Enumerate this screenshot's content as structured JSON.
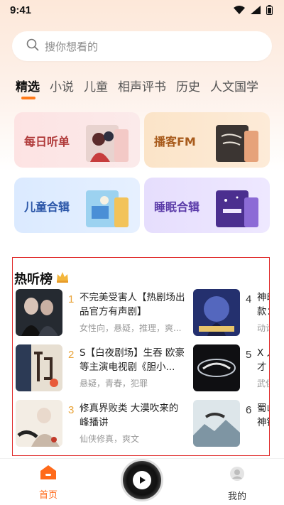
{
  "status": {
    "time": "9:41",
    "icons": [
      "wifi-icon",
      "signal-icon",
      "battery-icon"
    ]
  },
  "search": {
    "placeholder": "搜你想看的",
    "icon": "search-icon"
  },
  "tabs": [
    {
      "label": "精选",
      "active": true
    },
    {
      "label": "小说",
      "active": false
    },
    {
      "label": "儿童",
      "active": false
    },
    {
      "label": "相声评书",
      "active": false
    },
    {
      "label": "历史",
      "active": false
    },
    {
      "label": "人文国学",
      "active": false
    }
  ],
  "cards": [
    {
      "label": "每日听单"
    },
    {
      "label": "播客FM"
    },
    {
      "label": "儿童合辑"
    },
    {
      "label": "睡眠合辑"
    }
  ],
  "ranking": {
    "title": "热听榜",
    "items": [
      {
        "rank": "1",
        "name": "不完美受害人【热剧场出品官方有声剧】",
        "tags": "女性向，悬疑，推理，爽..."
      },
      {
        "rank": "2",
        "name": "S【白夜剧场】生吞 欧豪等主演电视剧《胆小...",
        "tags": "悬疑，青春，犯罪"
      },
      {
        "rank": "3",
        "name": "修真界败类 大漠吹来的峰播讲",
        "tags": "仙侠修真，爽文"
      },
      {
        "rank": "4",
        "name": "神印款：",
        "tags": "动诊"
      },
      {
        "rank": "5",
        "name": "X 人才",
        "tags": "武供"
      },
      {
        "rank": "6",
        "name": "蜀山神锋",
        "tags": ""
      }
    ]
  },
  "nav": {
    "home": "首页",
    "mine": "我的"
  },
  "colors": {
    "accent": "#ff7a1a",
    "frame": "#e02c2c",
    "rank_gold": "#e9a43a"
  }
}
